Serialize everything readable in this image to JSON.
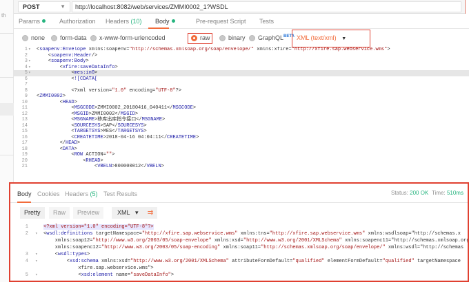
{
  "sidebar": {
    "partial_text": "th"
  },
  "request": {
    "method": "POST",
    "method_caret": "▼",
    "url": "http://localhost:8082/web/services/ZMMI0002_1?WSDL"
  },
  "request_tabs": {
    "params": "Params",
    "authorization": "Authorization",
    "headers": "Headers",
    "headers_count": "(10)",
    "body": "Body",
    "prerequest": "Pre-request Script",
    "tests": "Tests"
  },
  "body_types": {
    "none": "none",
    "form_data": "form-data",
    "urlencoded": "x-www-form-urlencoded",
    "raw": "raw",
    "binary": "binary",
    "graphql": "GraphQL",
    "graphql_badge": "BETA",
    "content_type": "XML (text/xml)",
    "content_type_caret": "▼"
  },
  "request_body": [
    {
      "n": "1",
      "f": "▾",
      "t": "<soapenv:Envelope xmlns:soapenv=\"http://schemas.xmlsoap.org/soap/envelope/\" xmlns:xfire=\"http://xfire.sap.webservice.wms\">"
    },
    {
      "n": "2",
      "f": "",
      "t": "    <soapenv:Header/>"
    },
    {
      "n": "3",
      "f": "▾",
      "t": "    <soapenv:Body>"
    },
    {
      "n": "4",
      "f": "▾",
      "t": "        <xfire:saveDataInfo>"
    },
    {
      "n": "5",
      "f": "▾",
      "t": "            <mes:in0>",
      "hl": true
    },
    {
      "n": "6",
      "f": "",
      "t": "            <![CDATA["
    },
    {
      "n": "7",
      "f": "",
      "t": ""
    },
    {
      "n": "8",
      "f": "",
      "t": "            <?xml version=\"1.0\" encoding=\"UTF-8\"?>"
    },
    {
      "n": "9",
      "f": "",
      "t": "<ZMMI0002>"
    },
    {
      "n": "10",
      "f": "",
      "t": "        <HEAD>"
    },
    {
      "n": "11",
      "f": "",
      "t": "            <MSGCODE>ZMMI0002_20180416_040411</MSGCODE>"
    },
    {
      "n": "12",
      "f": "",
      "t": "            <MSGID>ZMMI0002</MSGID>"
    },
    {
      "n": "13",
      "f": "",
      "t": "            <MSGNAME>移库出库指令接口</MSGNAME>"
    },
    {
      "n": "14",
      "f": "",
      "t": "            <SOURCESYS>SAP</SOURCESYS>"
    },
    {
      "n": "15",
      "f": "",
      "t": "            <TARGETSYS>MES</TARGETSYS>"
    },
    {
      "n": "16",
      "f": "",
      "t": "            <CREATETIME>2018-04-16 04:04:11</CREATETIME>"
    },
    {
      "n": "17",
      "f": "",
      "t": "        </HEAD>"
    },
    {
      "n": "18",
      "f": "",
      "t": "        <DATA>"
    },
    {
      "n": "19",
      "f": "",
      "t": "            <ROW ACTION=\"\">"
    },
    {
      "n": "20",
      "f": "",
      "t": "                <RHEAD>"
    },
    {
      "n": "21",
      "f": "",
      "t": "                    <VBELN>800000012</VBELN>"
    }
  ],
  "response_tabs": {
    "body": "Body",
    "cookies": "Cookies",
    "headers": "Headers",
    "headers_count": "(5)",
    "test_results": "Test Results"
  },
  "response_status": {
    "status_label": "Status:",
    "status_value": "200 OK",
    "time_label": "Time:",
    "time_value": "510ms",
    "status_color": "#26b47f"
  },
  "response_view": {
    "pretty": "Pretty",
    "raw": "Raw",
    "preview": "Preview",
    "format": "XML",
    "format_caret": "▾",
    "wrap_icon": "wrap-lines-icon"
  },
  "response_body": [
    {
      "n": "1",
      "f": "",
      "t": "<?xml version=\"1.0\" encoding=\"UTF-8\"?>",
      "pi": true
    },
    {
      "n": "2",
      "f": "▾",
      "t": "<wsdl:definitions targetNamespace=\"http://xfire.sap.webservice.wms\" xmlns:tns=\"http://xfire.sap.webservice.wms\" xmlns:wsdlsoap=\"http://schemas.x"
    },
    {
      "n": "",
      "f": "",
      "t": "    xmlns:soap12=\"http://www.w3.org/2003/05/soap-envelope\" xmlns:xsd=\"http://www.w3.org/2001/XMLSchema\" xmlns:soapenc11=\"http://schemas.xmlsoap.org"
    },
    {
      "n": "",
      "f": "",
      "t": "    xmlns:soapenc12=\"http://www.w3.org/2003/05/soap-encoding\" xmlns:soap11=\"http://schemas.xmlsoap.org/soap/envelope/\" xmlns:wsdl=\"http://schemas"
    },
    {
      "n": "3",
      "f": "▾",
      "t": "    <wsdl:types>"
    },
    {
      "n": "4",
      "f": "▾",
      "t": "        <xsd:schema xmlns:xsd=\"http://www.w3.org/2001/XMLSchema\" attributeFormDefault=\"qualified\" elementFormDefault=\"qualified\" targetNamespace"
    },
    {
      "n": "",
      "f": "",
      "t": "            xfire.sap.webservice.wms\">"
    },
    {
      "n": "5",
      "f": "▾",
      "t": "            <xsd:element name=\"saveDataInfo\">"
    }
  ],
  "colors": {
    "accent": "#f26b3a",
    "annotation": "#e04030",
    "tag": "#1a1aa6",
    "string": "#a31515"
  }
}
